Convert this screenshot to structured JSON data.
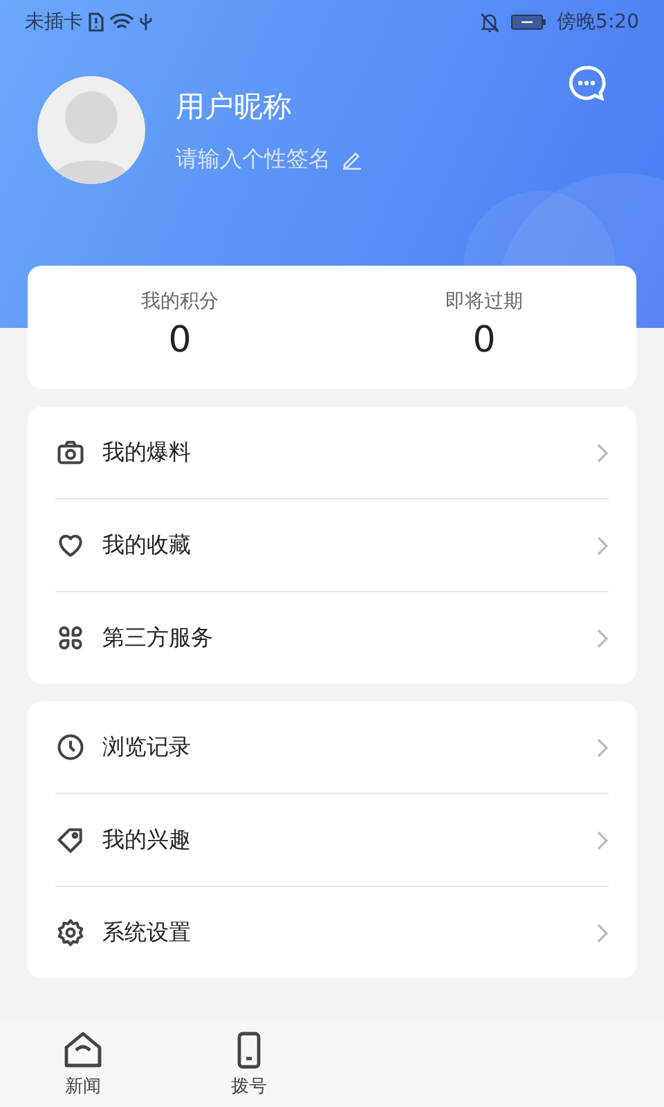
{
  "status_bar": {
    "carrier": "未插卡",
    "time": "傍晚5:20"
  },
  "profile": {
    "nickname": "用户昵称",
    "signature_placeholder": "请输入个性签名"
  },
  "points": [
    {
      "label": "我的积分",
      "value": "0"
    },
    {
      "label": "即将过期",
      "value": "0"
    }
  ],
  "menu_groups": [
    [
      {
        "label": "我的爆料"
      },
      {
        "label": "我的收藏"
      },
      {
        "label": "第三方服务"
      }
    ],
    [
      {
        "label": "浏览记录"
      },
      {
        "label": "我的兴趣"
      },
      {
        "label": "系统设置"
      }
    ]
  ],
  "tab_bar": [
    {
      "label": "新闻",
      "selected": false
    },
    {
      "label": "拨号",
      "selected": false
    }
  ]
}
